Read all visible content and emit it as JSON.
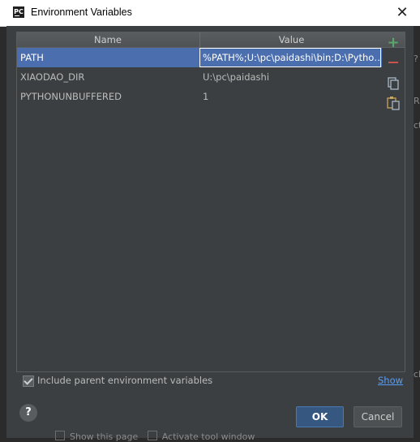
{
  "window": {
    "icon_text": "PC",
    "title": "Environment Variables",
    "close": "✕"
  },
  "table": {
    "columns": [
      "Name",
      "Value"
    ],
    "rows": [
      {
        "name": "PATH",
        "value": "%PATH%;U:\\pc\\paidashi\\bin;D:\\Pytho…",
        "selected": true
      },
      {
        "name": "XIAODAO_DIR",
        "value": "U:\\pc\\paidashi",
        "selected": false
      },
      {
        "name": "PYTHONUNBUFFERED",
        "value": "1",
        "selected": false
      }
    ]
  },
  "toolbar": {
    "add": "+",
    "remove": "−",
    "copy_icon": "copy-icon",
    "paste_icon": "paste-icon"
  },
  "options": {
    "include_parent_label": "Include parent environment variables",
    "include_parent_checked": true,
    "show_link": "Show"
  },
  "buttons": {
    "help": "?",
    "ok": "OK",
    "cancel": "Cancel"
  },
  "background": {
    "show_this_page": "Show this page",
    "activate_tool_window": "Activate tool window",
    "edge_marks": [
      "?",
      "R=",
      "ct",
      "cl"
    ]
  },
  "colors": {
    "selection": "#4b6eaf",
    "link": "#589df6",
    "add": "#59a869",
    "remove": "#c75450"
  }
}
